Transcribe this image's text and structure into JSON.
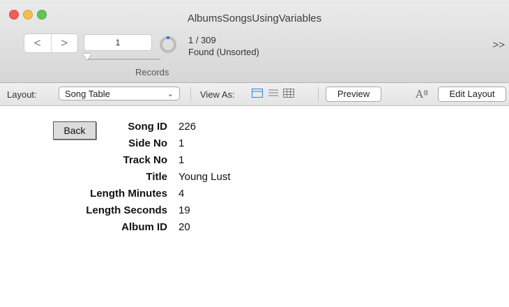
{
  "window": {
    "title": "AlbumsSongsUsingVariables"
  },
  "toolbar": {
    "prev_icon": "chevron-left-icon",
    "next_icon": "chevron-right-icon",
    "prev_glyph": "<",
    "next_glyph": ">",
    "record_number": "1",
    "record_count": "1 / 309",
    "found_status": "Found (Unsorted)",
    "records_label": "Records",
    "overflow_glyph": ">>"
  },
  "layout_bar": {
    "layout_label": "Layout:",
    "layout_value": "Song Table",
    "view_as_label": "View As:",
    "preview_label": "Preview",
    "font_glyph": "Aª",
    "edit_layout_label": "Edit Layout",
    "view_icons": [
      "form-view-icon",
      "list-view-icon",
      "table-view-icon"
    ]
  },
  "form": {
    "back_label": "Back",
    "fields": [
      {
        "label": "Song ID",
        "value": "226"
      },
      {
        "label": "Side No",
        "value": "1"
      },
      {
        "label": "Track No",
        "value": "1"
      },
      {
        "label": "Title",
        "value": "Young Lust"
      },
      {
        "label": "Length Minutes",
        "value": "4"
      },
      {
        "label": "Length Seconds",
        "value": "19"
      },
      {
        "label": "Album ID",
        "value": "20"
      }
    ]
  },
  "colors": {
    "accent": "#2f7cf6",
    "close": "#ee5f57",
    "minimize": "#f6be4f",
    "maximize": "#62c655"
  }
}
